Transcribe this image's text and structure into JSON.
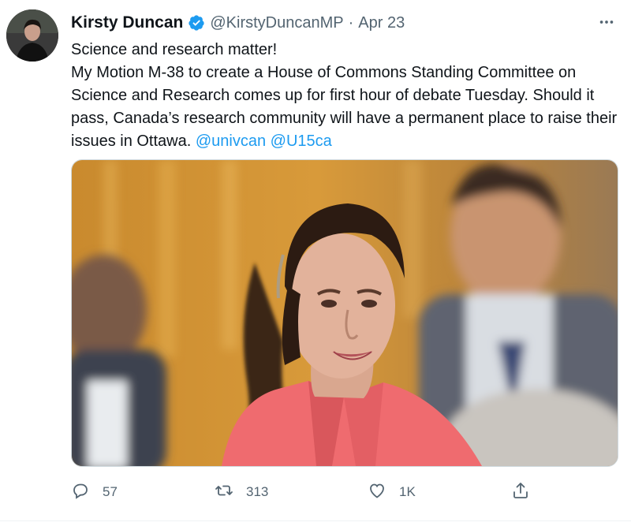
{
  "author": {
    "name": "Kirsty Duncan",
    "handle": "@KirstyDuncanMP",
    "separator": "·",
    "date": "Apr 23",
    "verified_color": "#1d9bf0"
  },
  "tweet": {
    "line1": "Science and research matter!",
    "line2": "My Motion M-38 to create a House of Commons Standing Committee on Science and Research comes up for first hour of debate Tuesday. Should it pass, Canada’s research community will have a permanent place to raise their issues in Ottawa. ",
    "mention1": "@univcan",
    "mention2": "@U15ca",
    "link_color": "#1d9bf0"
  },
  "actions": {
    "reply_count": "57",
    "retweet_count": "313",
    "like_count": "1K",
    "icon_color": "#536471"
  },
  "icons": {
    "more": "more-horizontal-icon",
    "reply": "reply-icon",
    "retweet": "retweet-icon",
    "like": "heart-icon",
    "share": "share-icon",
    "verified": "verified-badge-icon"
  }
}
